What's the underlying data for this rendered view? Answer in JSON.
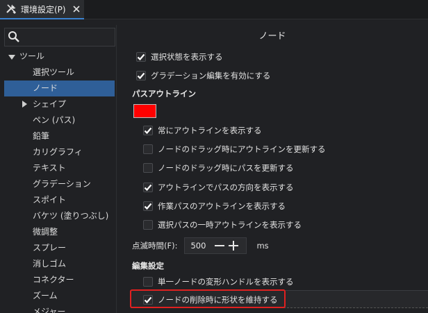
{
  "tab": {
    "title": "環境設定(P)",
    "close": "✕"
  },
  "search": {
    "placeholder": ""
  },
  "tree": {
    "items": [
      {
        "label": "ツール"
      },
      {
        "label": "選択ツール"
      },
      {
        "label": "ノード"
      },
      {
        "label": "シェイプ"
      },
      {
        "label": "ペン (パス)"
      },
      {
        "label": "鉛筆"
      },
      {
        "label": "カリグラフィ"
      },
      {
        "label": "テキスト"
      },
      {
        "label": "グラデーション"
      },
      {
        "label": "スポイト"
      },
      {
        "label": "バケツ (塗りつぶし)"
      },
      {
        "label": "微調整"
      },
      {
        "label": "スプレー"
      },
      {
        "label": "消しゴム"
      },
      {
        "label": "コネクター"
      },
      {
        "label": "ズーム"
      },
      {
        "label": "メジャー"
      }
    ]
  },
  "page": {
    "title": "ノード"
  },
  "options": {
    "show_selection": {
      "label": "選択状態を表示する",
      "checked": true
    },
    "gradient_edit": {
      "label": "グラデーション編集を有効にする",
      "checked": true
    }
  },
  "path_outline": {
    "heading": "パスアウトライン",
    "color": "#ff0000",
    "items": [
      {
        "label": "常にアウトラインを表示する",
        "checked": true
      },
      {
        "label": "ノードのドラッグ時にアウトラインを更新する",
        "checked": false
      },
      {
        "label": "ノードのドラッグ時にパスを更新する",
        "checked": false
      },
      {
        "label": "アウトラインでパスの方向を表示する",
        "checked": true
      },
      {
        "label": "作業パスのアウトラインを表示する",
        "checked": true
      },
      {
        "label": "選択パスの一時アウトラインを表示する",
        "checked": false
      }
    ]
  },
  "blink": {
    "label": "点滅時間(F):",
    "value": "500",
    "unit": "ms"
  },
  "edit_settings": {
    "heading": "編集設定",
    "items": [
      {
        "label": "単一ノードの変形ハンドルを表示する",
        "checked": false
      },
      {
        "label": "ノードの削除時に形状を維持する",
        "checked": true
      }
    ]
  },
  "colors": {
    "accent": "#3b82d1",
    "selection": "#2f5f98",
    "highlight_box": "#e02020"
  }
}
